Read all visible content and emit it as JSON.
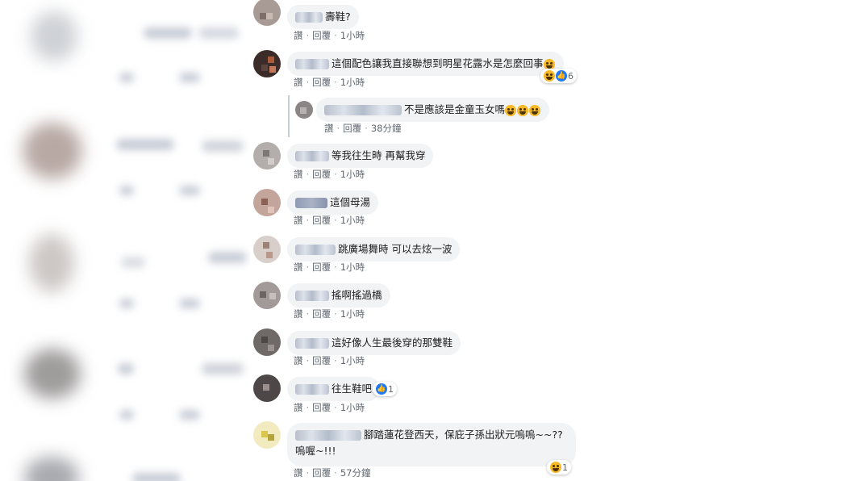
{
  "comments": [
    {
      "text": "壽鞋?",
      "like": "讚",
      "reply": "回覆",
      "time": "1小時"
    },
    {
      "text": "這個配色讓我直接聯想到明星花露水是怎麼回事",
      "like": "讚",
      "reply": "回覆",
      "time": "1小時",
      "reaction_count": "6"
    },
    {
      "text": "不是應該是金童玉女嗎",
      "like": "讚",
      "reply": "回覆",
      "time": "38分鐘"
    },
    {
      "text": "等我往生時 再幫我穿",
      "like": "讚",
      "reply": "回覆",
      "time": "1小時"
    },
    {
      "text": "這個母湯",
      "like": "讚",
      "reply": "回覆",
      "time": "1小時"
    },
    {
      "text": "跳廣場舞時 可以去炫一波",
      "like": "讚",
      "reply": "回覆",
      "time": "1小時"
    },
    {
      "text": "搖啊搖過橋",
      "like": "讚",
      "reply": "回覆",
      "time": "1小時"
    },
    {
      "text": "這好像人生最後穿的那雙鞋",
      "like": "讚",
      "reply": "回覆",
      "time": "1小時"
    },
    {
      "text": "往生鞋吧",
      "like": "讚",
      "reply": "回覆",
      "time": "1小時",
      "reaction_count": "1"
    },
    {
      "text_line1": "腳踏蓮花登西天，保庇子孫出狀元嗚嗚~~??",
      "text_line2": "嗚喔~!!!",
      "like": "讚",
      "reply": "回覆",
      "time": "57分鐘",
      "reaction_count": "1"
    }
  ],
  "colors": {
    "bubble": "#f2f3f5",
    "link": "#606770",
    "like_blue": "#2078f4",
    "haha_yellow": "#f7b928"
  },
  "icons": [
    "haha-emoji-icon",
    "like-icon"
  ]
}
